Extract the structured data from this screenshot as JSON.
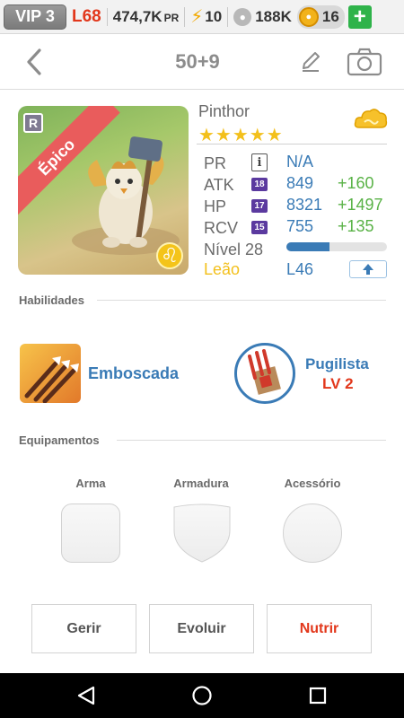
{
  "status_bar": {
    "vip": "VIP 3",
    "level": "L68",
    "power_value": "474,7K",
    "power_unit": "PR",
    "energy": "10",
    "food": "188K",
    "coins": "16",
    "add": "+"
  },
  "header": {
    "title": "50+9"
  },
  "pet": {
    "name": "Pinthor",
    "rarity": "Épico",
    "rarity_badge": "R",
    "stars": "★★★★★",
    "zodiac_symbol": "♌",
    "stats": [
      {
        "label": "PR",
        "value": "N/A",
        "bonus": ""
      },
      {
        "label": "ATK",
        "rank": "18",
        "value": "849",
        "bonus": "+160"
      },
      {
        "label": "HP",
        "rank": "17",
        "value": "8321",
        "bonus": "+1497"
      },
      {
        "label": "RCV",
        "rank": "15",
        "value": "755",
        "bonus": "+135"
      }
    ],
    "level_label": "Nível 28",
    "level_progress": 0.43,
    "sign_label": "Leão",
    "sign_level": "L46"
  },
  "abilities": {
    "title": "Habilidades",
    "skills": [
      {
        "name": "Emboscada"
      },
      {
        "name": "Pugilista",
        "level": "LV 2"
      }
    ]
  },
  "equipment": {
    "title": "Equipamentos",
    "slots": [
      "Arma",
      "Armadura",
      "Acessório"
    ]
  },
  "actions": {
    "manage": "Gerir",
    "evolve": "Evoluir",
    "feed": "Nutrir"
  },
  "colors": {
    "accent_blue": "#3a7bb6",
    "bonus_green": "#59b246",
    "alert_red": "#e2371b",
    "gold": "#f3c01c"
  }
}
